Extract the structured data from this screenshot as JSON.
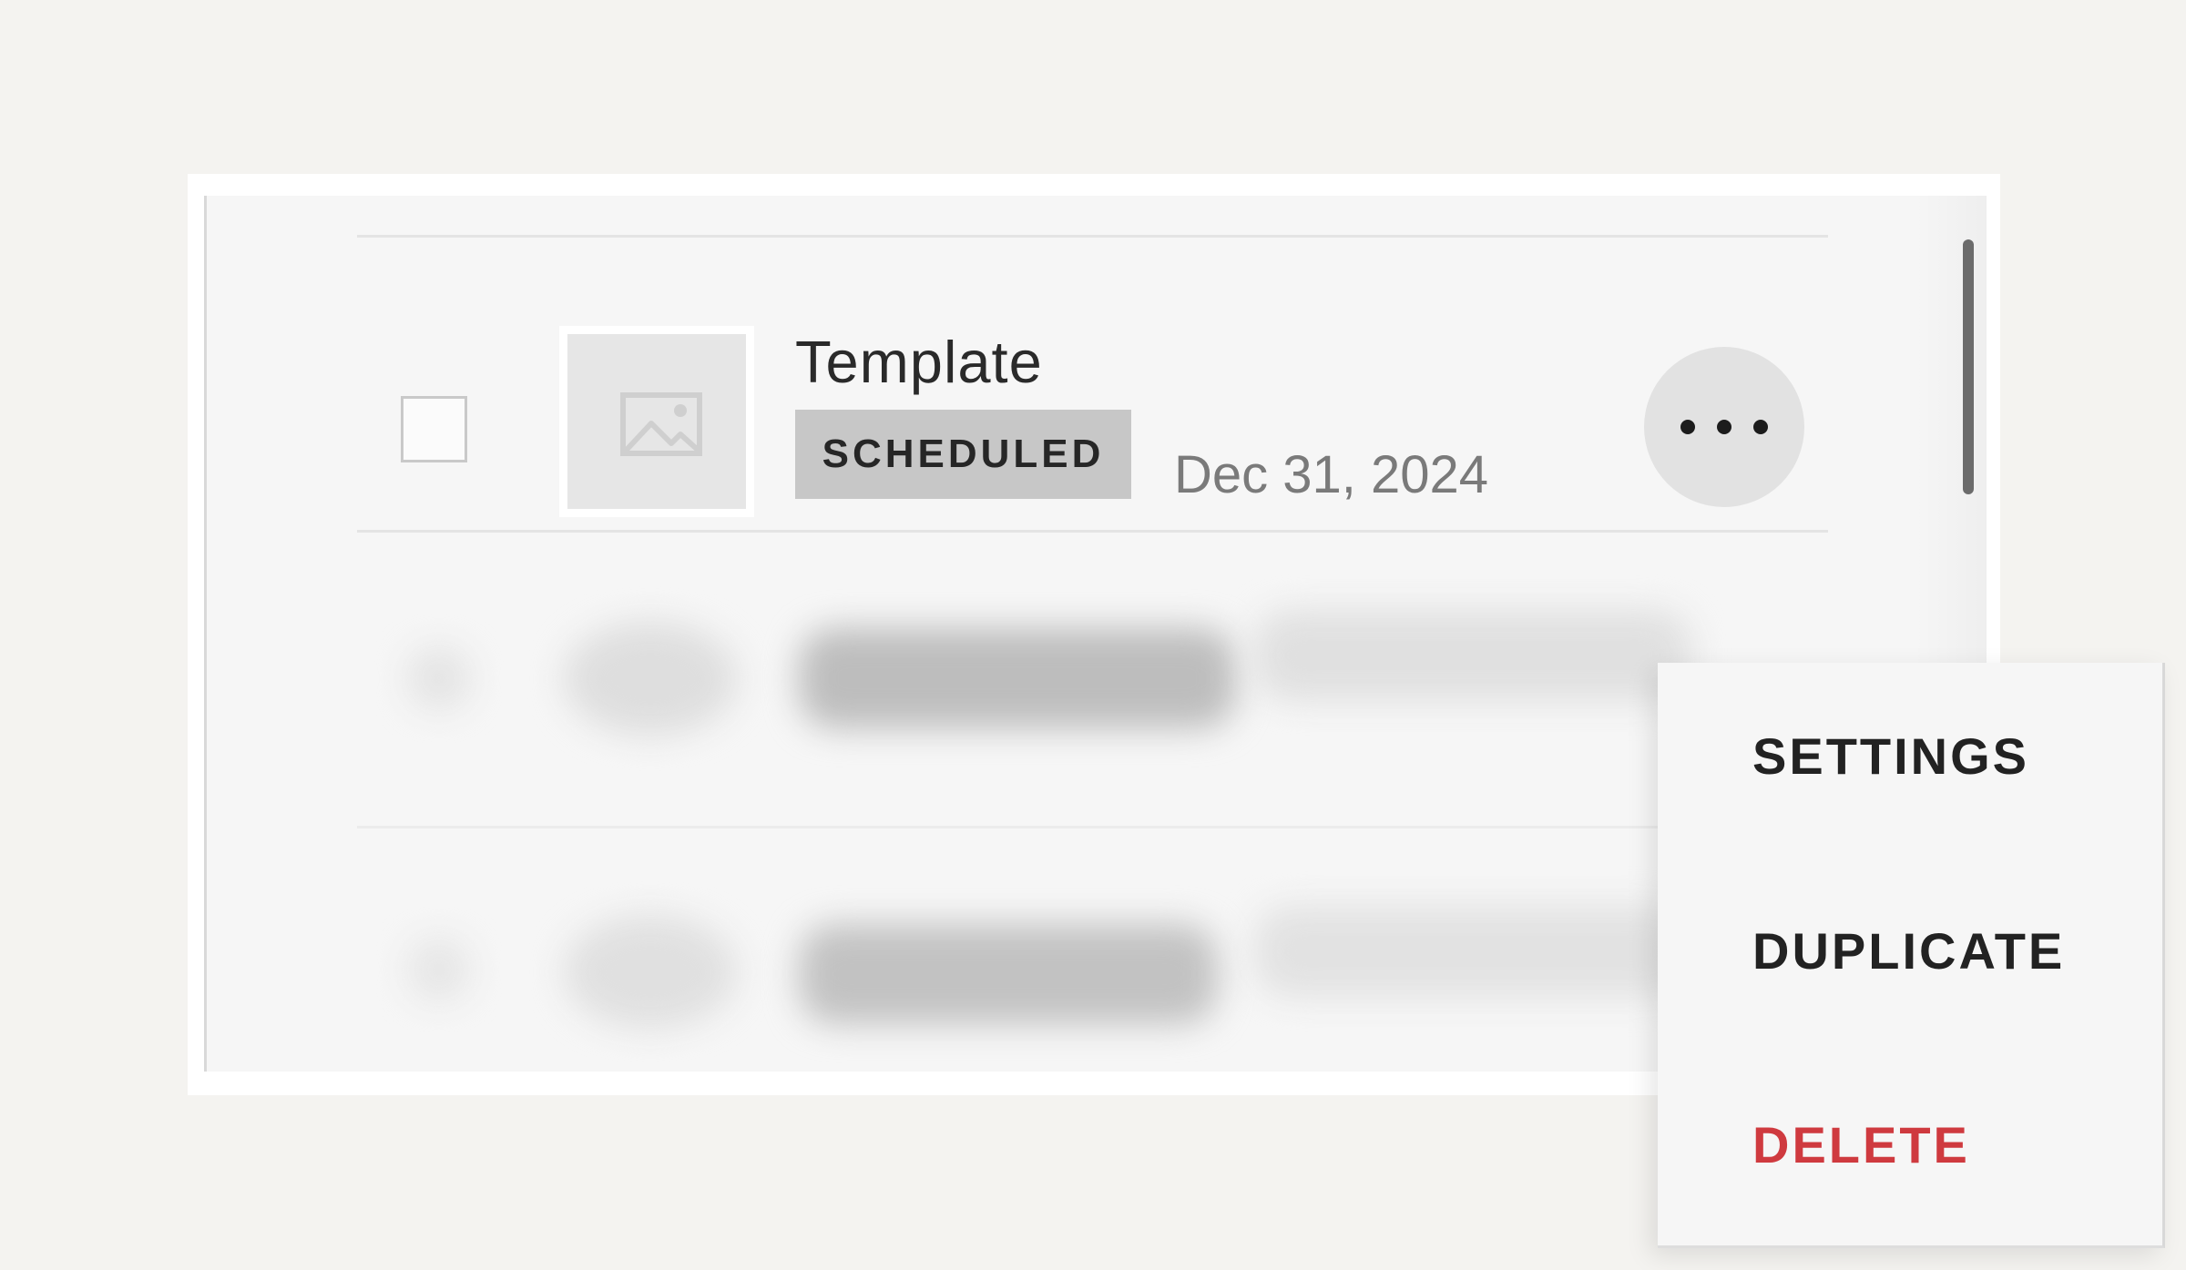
{
  "row": {
    "title": "Template",
    "status_badge": "SCHEDULED",
    "date": "Dec 31, 2024"
  },
  "menu": {
    "items": [
      {
        "label": "SETTINGS"
      },
      {
        "label": "DUPLICATE"
      },
      {
        "label": "DELETE"
      }
    ]
  },
  "icons": {
    "thumbnail": "image-placeholder-icon",
    "more": "more-horizontal-icon"
  },
  "colors": {
    "background": "#f4f3f0",
    "panel": "#f6f6f6",
    "badge": "#c7c7c7",
    "delete": "#cf3a3f"
  }
}
